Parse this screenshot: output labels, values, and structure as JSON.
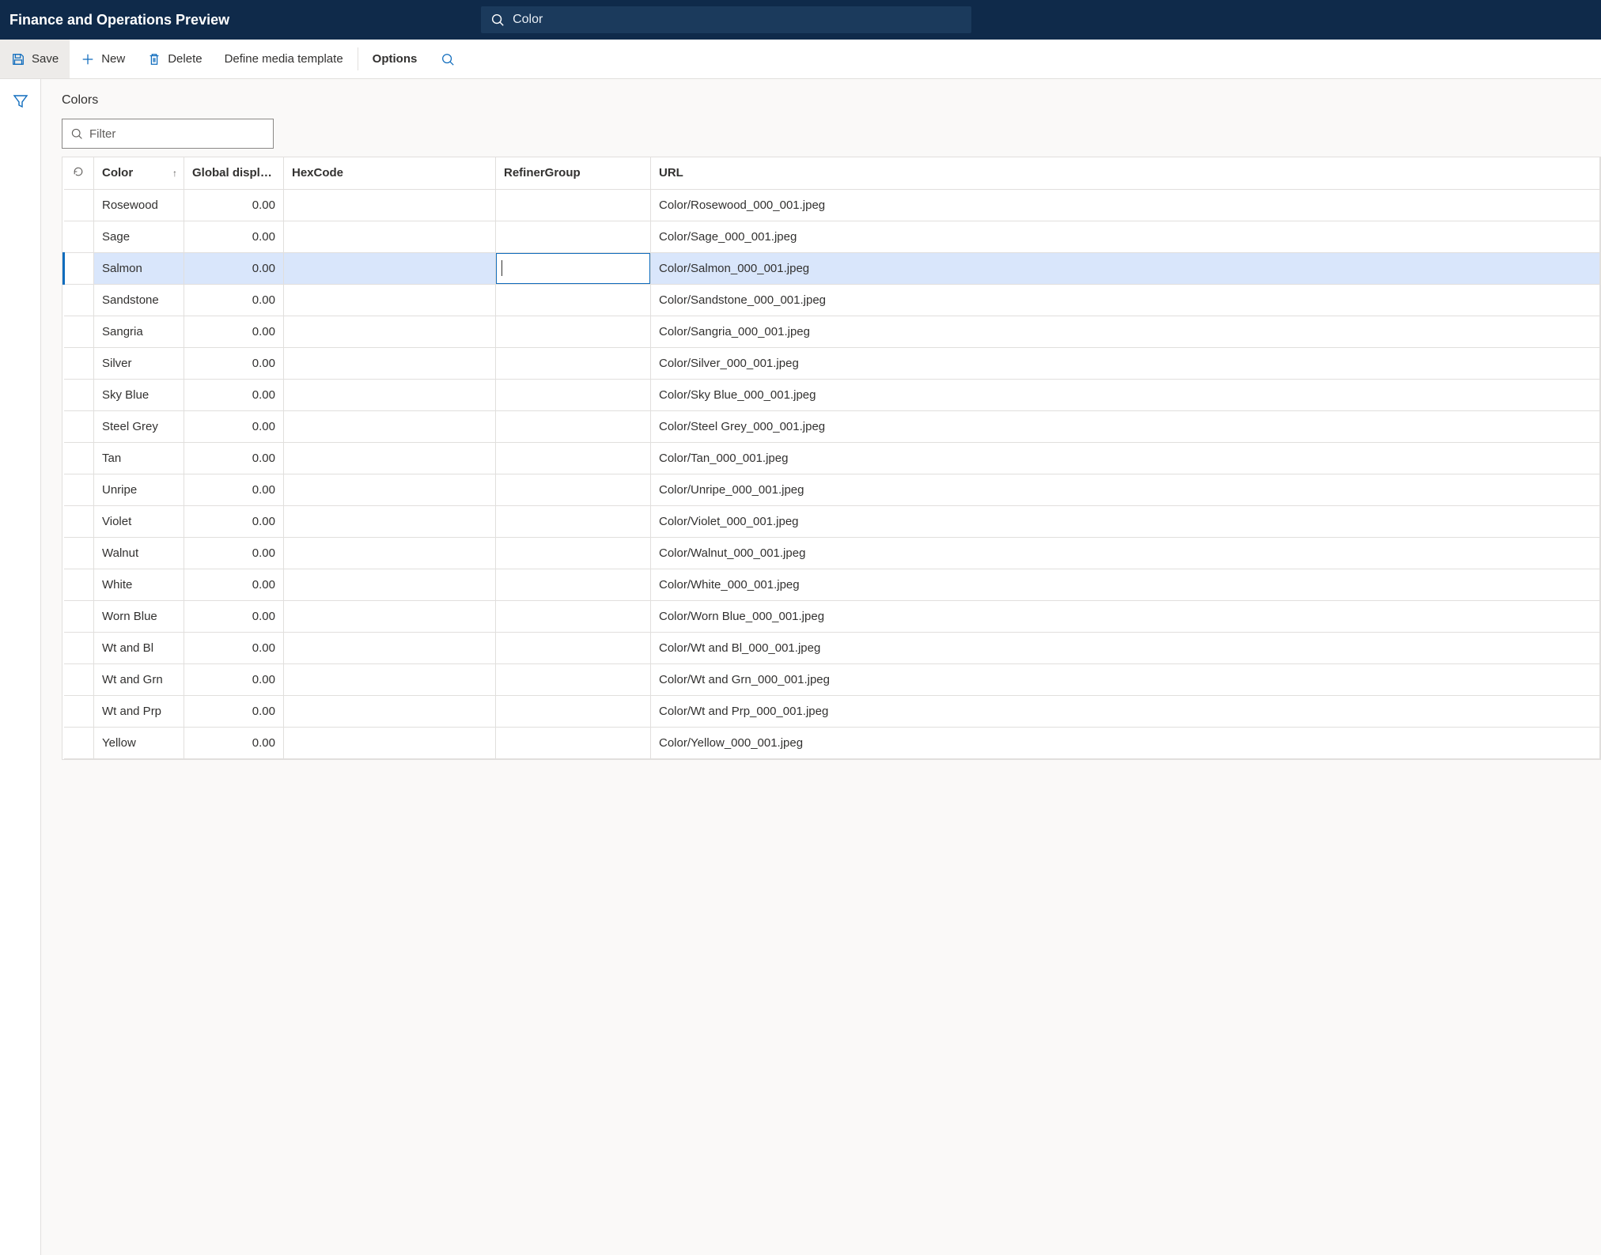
{
  "app": {
    "title": "Finance and Operations Preview",
    "search_value": "Color"
  },
  "commands": {
    "save": "Save",
    "new": "New",
    "delete": "Delete",
    "define_media": "Define media template",
    "options": "Options"
  },
  "page": {
    "heading": "Colors",
    "filter_placeholder": "Filter"
  },
  "grid": {
    "headers": {
      "color": "Color",
      "global_display": "Global display ...",
      "hexcode": "HexCode",
      "refiner": "RefinerGroup",
      "url": "URL"
    },
    "selected_index": 2,
    "editing_column": "refiner",
    "rows": [
      {
        "color": "Rosewood",
        "display": "0.00",
        "hex": "",
        "refiner": "",
        "url": "Color/Rosewood_000_001.jpeg"
      },
      {
        "color": "Sage",
        "display": "0.00",
        "hex": "",
        "refiner": "",
        "url": "Color/Sage_000_001.jpeg"
      },
      {
        "color": "Salmon",
        "display": "0.00",
        "hex": "",
        "refiner": "",
        "url": "Color/Salmon_000_001.jpeg"
      },
      {
        "color": "Sandstone",
        "display": "0.00",
        "hex": "",
        "refiner": "",
        "url": "Color/Sandstone_000_001.jpeg"
      },
      {
        "color": "Sangria",
        "display": "0.00",
        "hex": "",
        "refiner": "",
        "url": "Color/Sangria_000_001.jpeg"
      },
      {
        "color": "Silver",
        "display": "0.00",
        "hex": "",
        "refiner": "",
        "url": "Color/Silver_000_001.jpeg"
      },
      {
        "color": "Sky Blue",
        "display": "0.00",
        "hex": "",
        "refiner": "",
        "url": "Color/Sky Blue_000_001.jpeg"
      },
      {
        "color": "Steel Grey",
        "display": "0.00",
        "hex": "",
        "refiner": "",
        "url": "Color/Steel Grey_000_001.jpeg"
      },
      {
        "color": "Tan",
        "display": "0.00",
        "hex": "",
        "refiner": "",
        "url": "Color/Tan_000_001.jpeg"
      },
      {
        "color": "Unripe",
        "display": "0.00",
        "hex": "",
        "refiner": "",
        "url": "Color/Unripe_000_001.jpeg"
      },
      {
        "color": "Violet",
        "display": "0.00",
        "hex": "",
        "refiner": "",
        "url": "Color/Violet_000_001.jpeg"
      },
      {
        "color": "Walnut",
        "display": "0.00",
        "hex": "",
        "refiner": "",
        "url": "Color/Walnut_000_001.jpeg"
      },
      {
        "color": "White",
        "display": "0.00",
        "hex": "",
        "refiner": "",
        "url": "Color/White_000_001.jpeg"
      },
      {
        "color": "Worn Blue",
        "display": "0.00",
        "hex": "",
        "refiner": "",
        "url": "Color/Worn Blue_000_001.jpeg"
      },
      {
        "color": "Wt and Bl",
        "display": "0.00",
        "hex": "",
        "refiner": "",
        "url": "Color/Wt and Bl_000_001.jpeg"
      },
      {
        "color": "Wt and Grn",
        "display": "0.00",
        "hex": "",
        "refiner": "",
        "url": "Color/Wt and Grn_000_001.jpeg"
      },
      {
        "color": "Wt and Prp",
        "display": "0.00",
        "hex": "",
        "refiner": "",
        "url": "Color/Wt and Prp_000_001.jpeg"
      },
      {
        "color": "Yellow",
        "display": "0.00",
        "hex": "",
        "refiner": "",
        "url": "Color/Yellow_000_001.jpeg"
      }
    ]
  }
}
